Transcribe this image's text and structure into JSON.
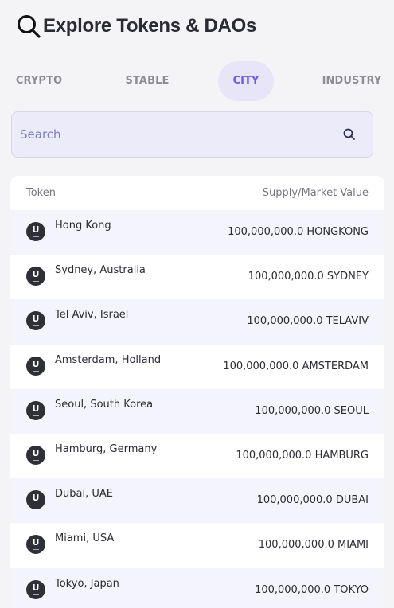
{
  "header": {
    "title": "Explore Tokens & DAOs",
    "icon": "search-icon"
  },
  "tabs": [
    {
      "label": "CRYPTO",
      "active": false
    },
    {
      "label": "STABLE",
      "active": false
    },
    {
      "label": "CITY",
      "active": true
    },
    {
      "label": "INDUSTRY",
      "active": false
    }
  ],
  "search": {
    "placeholder": "Search",
    "value": "",
    "icon": "search-icon"
  },
  "table": {
    "columns": {
      "token": "Token",
      "supply": "Supply/Market Value"
    },
    "rows": [
      {
        "name": "Hong Kong",
        "value": "100,000,000.0 HONGKONG",
        "icon": "token-logo-icon"
      },
      {
        "name": "Sydney, Australia",
        "value": "100,000,000.0 SYDNEY",
        "icon": "token-logo-icon"
      },
      {
        "name": "Tel Aviv, Israel",
        "value": "100,000,000.0 TELAVIV",
        "icon": "token-logo-icon"
      },
      {
        "name": "Amsterdam, Holland",
        "value": "100,000,000.0 AMSTERDAM",
        "icon": "token-logo-icon"
      },
      {
        "name": "Seoul, South Korea",
        "value": "100,000,000.0 SEOUL",
        "icon": "token-logo-icon"
      },
      {
        "name": "Hamburg, Germany",
        "value": "100,000,000.0 HAMBURG",
        "icon": "token-logo-icon"
      },
      {
        "name": "Dubai, UAE",
        "value": "100,000,000.0 DUBAI",
        "icon": "token-logo-icon"
      },
      {
        "name": "Miami, USA",
        "value": "100,000,000.0 MIAMI",
        "icon": "token-logo-icon"
      },
      {
        "name": "Tokyo, Japan",
        "value": "100,000,000.0 TOKYO",
        "icon": "token-logo-icon"
      }
    ]
  },
  "colors": {
    "accent": "#6c5ce7",
    "active_tab_bg": "#e7e5f7",
    "search_bg": "#ebebfa",
    "row_alt": "#f4f4fc"
  }
}
